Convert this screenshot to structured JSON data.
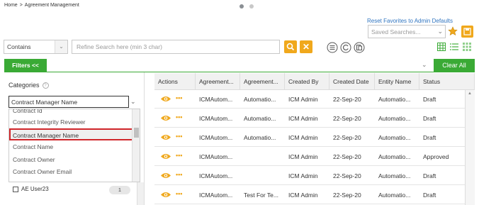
{
  "breadcrumb": {
    "home": "Home",
    "separator": ">",
    "current": "Agreement Management"
  },
  "header": {
    "reset_link": "Reset Favorites to Admin Defaults",
    "saved_searches_placeholder": "Saved Searches..."
  },
  "search": {
    "operator": "Contains",
    "placeholder": "Refine Search here (min 3 char)"
  },
  "filters": {
    "toggle_label": "Filters <<",
    "clear_all_label": "Clear All"
  },
  "categories": {
    "title": "Categories",
    "selected_value": "Contract Manager Name",
    "options": [
      "Contract Id",
      "Contract Integrity Reviewer",
      "Contract Manager Name",
      "Contract Name",
      "Contract Owner",
      "Contract Owner Email"
    ],
    "selected_index": 2
  },
  "user_filter": {
    "label": "AE User23",
    "count": "1"
  },
  "grid": {
    "columns": [
      "Actions",
      "Agreement...",
      "Agreement...",
      "Created By",
      "Created Date",
      "Entity Name",
      "Status"
    ],
    "rows": [
      {
        "code": "ICMAutom...",
        "name": "Automatio...",
        "created_by": "ICM Admin",
        "date": "22-Sep-20",
        "entity": "Automatio...",
        "status": "Draft"
      },
      {
        "code": "ICMAutom...",
        "name": "Automatio...",
        "created_by": "ICM Admin",
        "date": "22-Sep-20",
        "entity": "Automatio...",
        "status": "Draft"
      },
      {
        "code": "ICMAutom...",
        "name": "Automatio...",
        "created_by": "ICM Admin",
        "date": "22-Sep-20",
        "entity": "Automatio...",
        "status": "Draft"
      },
      {
        "code": "ICMAutom...",
        "name": "",
        "created_by": "ICM Admin",
        "date": "22-Sep-20",
        "entity": "Automatio...",
        "status": "Approved"
      },
      {
        "code": "ICMAutom...",
        "name": "",
        "created_by": "ICM Admin",
        "date": "22-Sep-20",
        "entity": "Automatio...",
        "status": "Draft"
      },
      {
        "code": "ICMAutom...",
        "name": "Test For Te...",
        "created_by": "ICM Admin",
        "date": "22-Sep-20",
        "entity": "Automatio...",
        "status": "Draft"
      }
    ]
  },
  "colors": {
    "accent_green": "#3aaa35",
    "accent_orange": "#f0a81c",
    "link_blue": "#2f74c0",
    "highlight_red": "#d0262a"
  },
  "icons": [
    "star-icon",
    "save-icon",
    "search-icon",
    "close-icon",
    "filter-icon",
    "refresh-icon",
    "list-icon",
    "grid-view-icon",
    "eye-icon",
    "more-icon",
    "help-icon"
  ]
}
